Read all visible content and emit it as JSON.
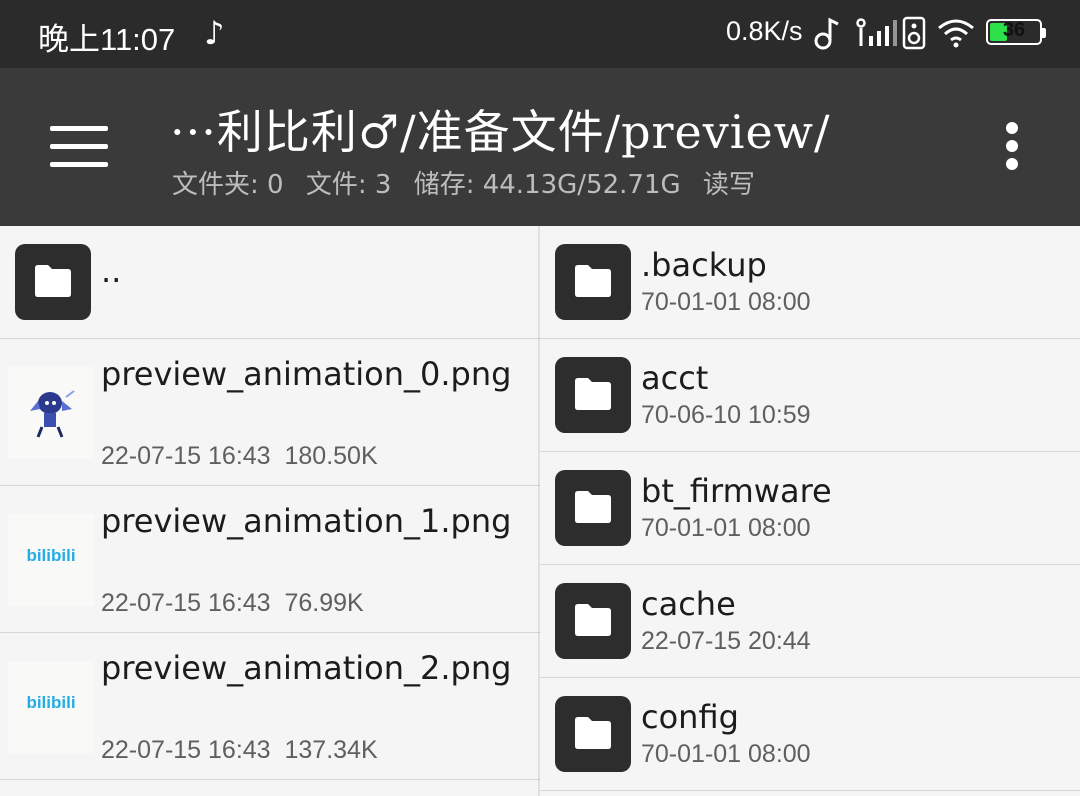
{
  "status_bar": {
    "time": "晚上11:07",
    "net_speed": "0.8K/s",
    "battery": "36",
    "battery_fraction": 0.36
  },
  "app_bar": {
    "path": "···利比利♂/准备文件/preview/",
    "folders": "文件夹: 0",
    "files": "文件: 3",
    "storage": "储存: 44.13G/52.71G",
    "mode": "读写"
  },
  "left_pane": {
    "parent": "..",
    "files": [
      {
        "name": "preview_animation_0.png",
        "date": "22-07-15 16:43",
        "size": "180.50K",
        "thumb": "anime-character"
      },
      {
        "name": "preview_animation_1.png",
        "date": "22-07-15 16:43",
        "size": "76.99K",
        "thumb": "bilibili-logo",
        "logo_text": "bilibili"
      },
      {
        "name": "preview_animation_2.png",
        "date": "22-07-15 16:43",
        "size": "137.34K",
        "thumb": "bilibili-logo",
        "logo_text": "bilibili"
      }
    ]
  },
  "right_pane": {
    "folders": [
      {
        "name": ".backup",
        "date": "70-01-01 08:00"
      },
      {
        "name": "acct",
        "date": "70-06-10 10:59"
      },
      {
        "name": "bt_firmware",
        "date": "70-01-01 08:00"
      },
      {
        "name": "cache",
        "date": "22-07-15 20:44"
      },
      {
        "name": "config",
        "date": "70-01-01 08:00"
      }
    ]
  },
  "colors": {
    "status_bg": "#2b2b2b",
    "appbar_bg": "#3a3a3a",
    "tile_bg": "#2d2d2d",
    "battery": "#2ee04a",
    "bilibili": "#23ade5"
  }
}
